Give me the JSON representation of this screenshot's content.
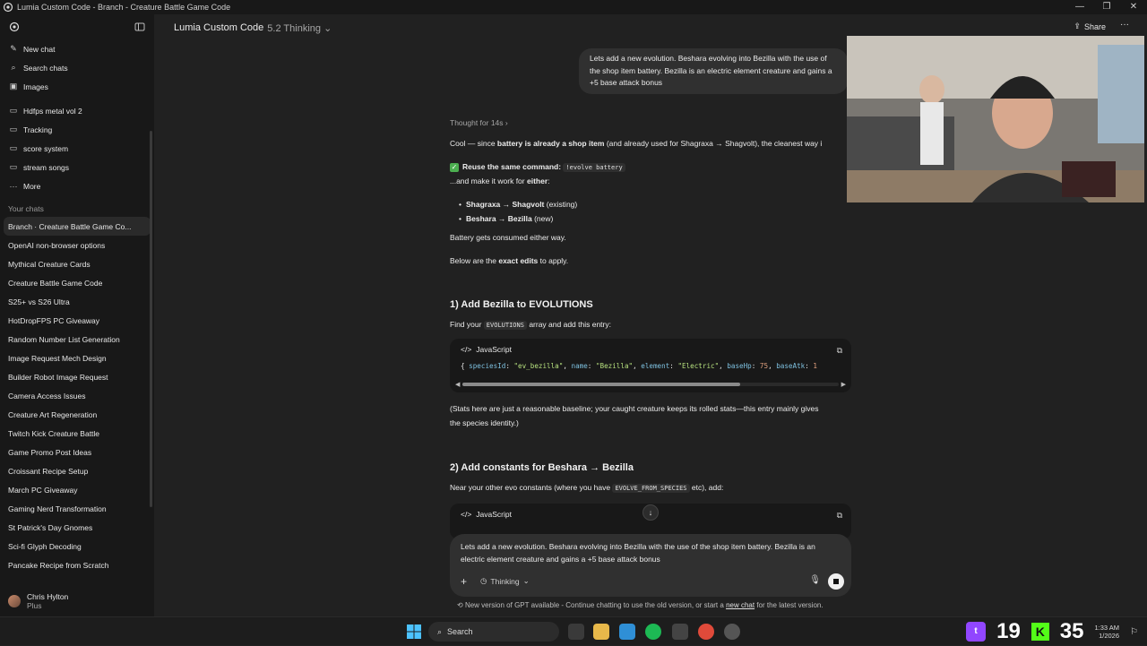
{
  "window": {
    "title": "Lumia Custom Code - Branch - Creature Battle Game Code"
  },
  "sidebar": {
    "nav": [
      {
        "label": "New chat",
        "icon": "edit-icon"
      },
      {
        "label": "Search chats",
        "icon": "search-icon"
      },
      {
        "label": "Images",
        "icon": "image-icon"
      }
    ],
    "projects": [
      {
        "label": "Hdfps metal vol 2"
      },
      {
        "label": "Tracking"
      },
      {
        "label": "score system"
      },
      {
        "label": "stream songs"
      },
      {
        "label": "More"
      }
    ],
    "your_chats_label": "Your chats",
    "chats": [
      "Branch · Creature Battle Game Co...",
      "OpenAI non-browser options",
      "Mythical Creature Cards",
      "Creature Battle Game Code",
      "S25+ vs S26 Ultra",
      "HotDropFPS PC Giveaway",
      "Random Number List Generation",
      "Image Request Mech Design",
      "Builder Robot Image Request",
      "Camera Access Issues",
      "Creature Art Regeneration",
      "Twitch Kick Creature Battle",
      "Game Promo Post Ideas",
      "Croissant Recipe Setup",
      "March PC Giveaway",
      "Gaming Nerd Transformation",
      "St Patrick's Day Gnomes",
      "Sci-fi Glyph Decoding",
      "Pancake Recipe from Scratch"
    ],
    "user": {
      "name": "Chris Hylton",
      "plan": "Plus"
    }
  },
  "header": {
    "project": "Lumia Custom Code",
    "model": "5.2 Thinking",
    "share": "Share"
  },
  "conversation": {
    "user_message": "Lets add a new evolution. Beshara evolving into Bezilla with the use of the shop item battery. Bezilla is an electric element creature and gains a +5 base attack bonus",
    "thought": "Thought for 14s",
    "intro_a": "Cool — since ",
    "intro_b": "battery is already a shop item",
    "intro_c": " (and already used for Shagraxa → Shagvolt), the cleanest way i",
    "reuse_label": "Reuse the same command:",
    "reuse_cmd": "!evolve battery",
    "make_work_a": "...and make it work for ",
    "make_work_b": "either",
    "make_work_c": ":",
    "bullets": [
      {
        "bold": "Shagraxa → Shagvolt",
        "rest": " (existing)"
      },
      {
        "bold": "Beshara → Bezilla",
        "rest": " (new)"
      }
    ],
    "consumed": "Battery gets consumed either way.",
    "below_a": "Below are the ",
    "below_b": "exact edits",
    "below_c": " to apply.",
    "step1_title": "1) Add Bezilla to EVOLUTIONS",
    "step1_a": "Find your ",
    "step1_code": "EVOLUTIONS",
    "step1_b": " array and add this entry:",
    "code1_lang": "JavaScript",
    "code1": {
      "k1": "speciesId",
      "v1": "\"ev_bezilla\"",
      "k2": "name",
      "v2": "\"Bezilla\"",
      "k3": "element",
      "v3": "\"Electric\"",
      "k4": "baseHp",
      "v4": "75",
      "k5": "baseAtk",
      "v5": "1"
    },
    "stats_note_1": "(Stats here are just a reasonable baseline; your caught creature keeps its rolled stats—this entry mainly gives",
    "stats_note_2": "the species identity.)",
    "step2_title": "2) Add constants for Beshara → Bezilla",
    "step2_a": "Near your other evo constants (where you have ",
    "step2_code": "EVOLVE_FROM_SPECIES",
    "step2_b": " etc), add:",
    "code2_lang": "JavaScript"
  },
  "composer": {
    "text": "Lets add a new evolution. Beshara evolving into Bezilla with the use of the shop item battery. Bezilla is an electric element creature and gains a +5 base attack bonus",
    "mode": "Thinking"
  },
  "notice": {
    "a": "New version of GPT available - Continue chatting to use the old version, or start a ",
    "link": "new chat",
    "b": " for the latest version."
  },
  "taskbar": {
    "search": "Search",
    "counter_a": "19",
    "counter_b": "35",
    "time": "1:33 AM",
    "date": "1/2026"
  },
  "colors": {
    "accent_twitch": "#9146ff",
    "accent_kick": "#53fc18",
    "check": "#4caf50"
  }
}
